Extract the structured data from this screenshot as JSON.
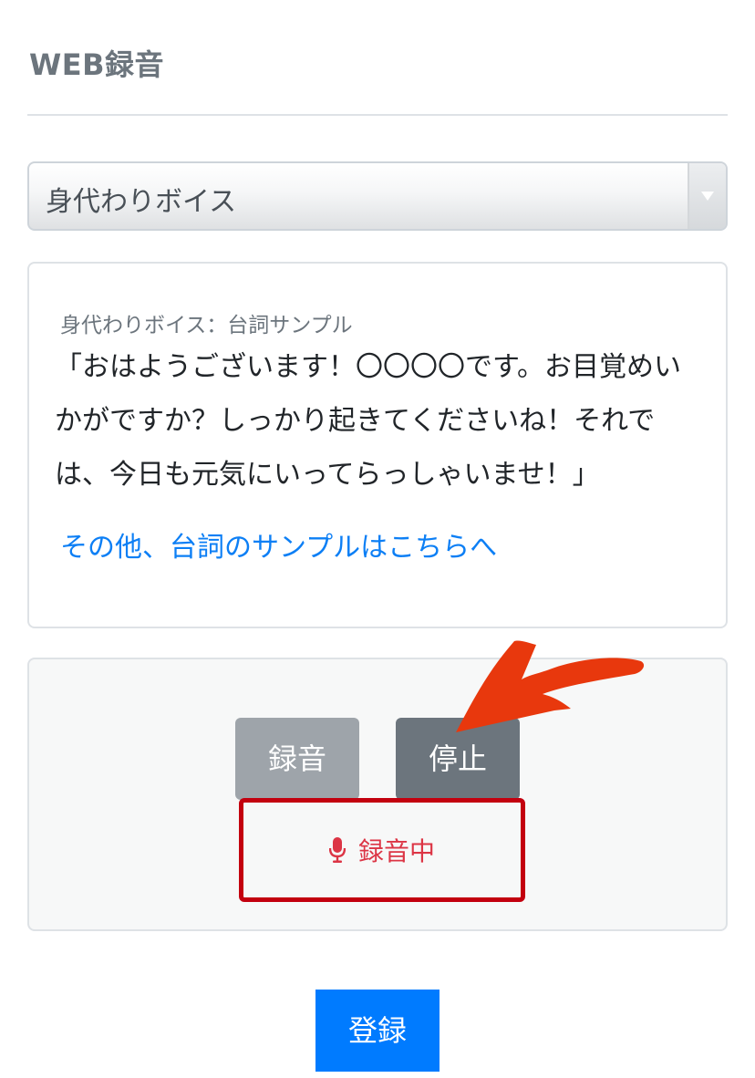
{
  "header": {
    "title": "WEB録音"
  },
  "voice_select": {
    "selected": "身代わりボイス",
    "arrow_icon": "triangle-down-icon"
  },
  "sample": {
    "caption": "身代わりボイス：台詞サンプル",
    "script": "「おはようございます！〇〇〇〇です。お目覚めいかがですか？しっかり起きてくださいね！それでは、今日も元気にいってらっしゃいませ！」",
    "link_label": "その他、台詞のサンプルはこちらへ"
  },
  "recorder": {
    "record_label": "録音",
    "stop_label": "停止",
    "status_label": "録音中",
    "status_icon": "microphone-icon",
    "status_color": "#dc3545",
    "highlight_color": "#c3000f",
    "annotation_arrow_color": "#e8380d"
  },
  "footer": {
    "register_label": "登録",
    "register_color": "#007bff"
  }
}
